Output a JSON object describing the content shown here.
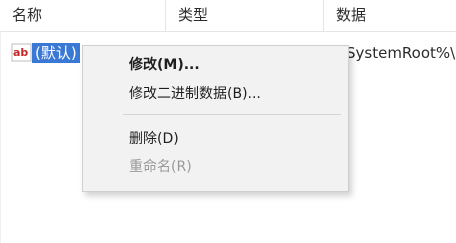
{
  "columns": {
    "name": "名称",
    "type": "类型",
    "data": "数据"
  },
  "row": {
    "icon": "string-value-icon",
    "icon_text": "ab",
    "name": "(默认)",
    "data": "SystemRoot%\\"
  },
  "context_menu": {
    "items": [
      {
        "label": "修改(M)...",
        "state": "default"
      },
      {
        "label": "修改二进制数据(B)...",
        "state": "enabled"
      },
      {
        "label": "删除(D)",
        "state": "enabled"
      },
      {
        "label": "重命名(R)",
        "state": "disabled"
      }
    ]
  },
  "colors": {
    "selection": "#3a78d6",
    "menu_background": "#f2f2f2",
    "disabled_text": "#9a9a9a"
  }
}
